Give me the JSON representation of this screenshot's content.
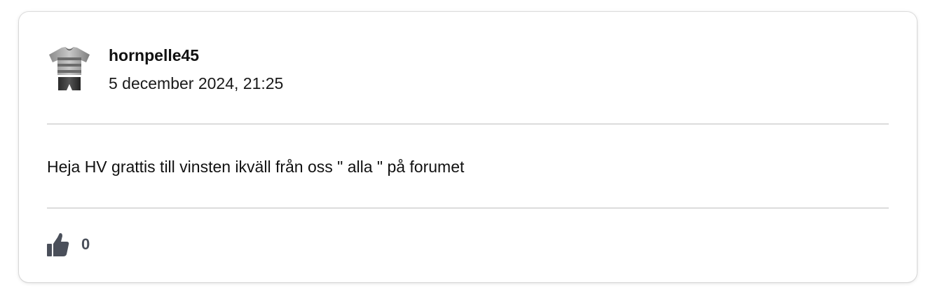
{
  "post": {
    "author": "hornpelle45",
    "date": "5 december 2024, 21:25",
    "body": "Heja HV grattis till vinsten ikväll från oss \" alla \" på forumet",
    "likes": "0",
    "avatar_icon": "jersey-icon",
    "like_icon": "thumbs-up-icon"
  },
  "colors": {
    "like_count": "#4a4f5a",
    "divider": "#dcdcdc"
  }
}
